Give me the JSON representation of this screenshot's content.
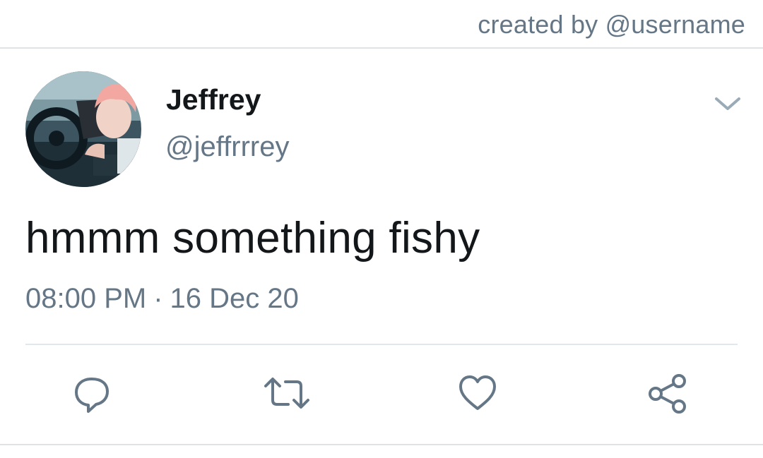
{
  "credit": "created by @username",
  "tweet": {
    "author_name": "Jeffrey",
    "author_handle": "@jeffrrrey",
    "text": "hmmm something fishy",
    "time": "08:00 PM",
    "separator": "·",
    "date": "16 Dec 20"
  },
  "actions": [
    {
      "icon": "reply-icon"
    },
    {
      "icon": "retweet-icon"
    },
    {
      "icon": "like-icon"
    },
    {
      "icon": "share-icon"
    }
  ],
  "menu": {
    "icon": "chevron-down-icon"
  },
  "colors": {
    "text": "#14171a",
    "secondary": "#657786",
    "divider": "#e1e8ed",
    "avatar_hair": "#f2a7a0"
  }
}
